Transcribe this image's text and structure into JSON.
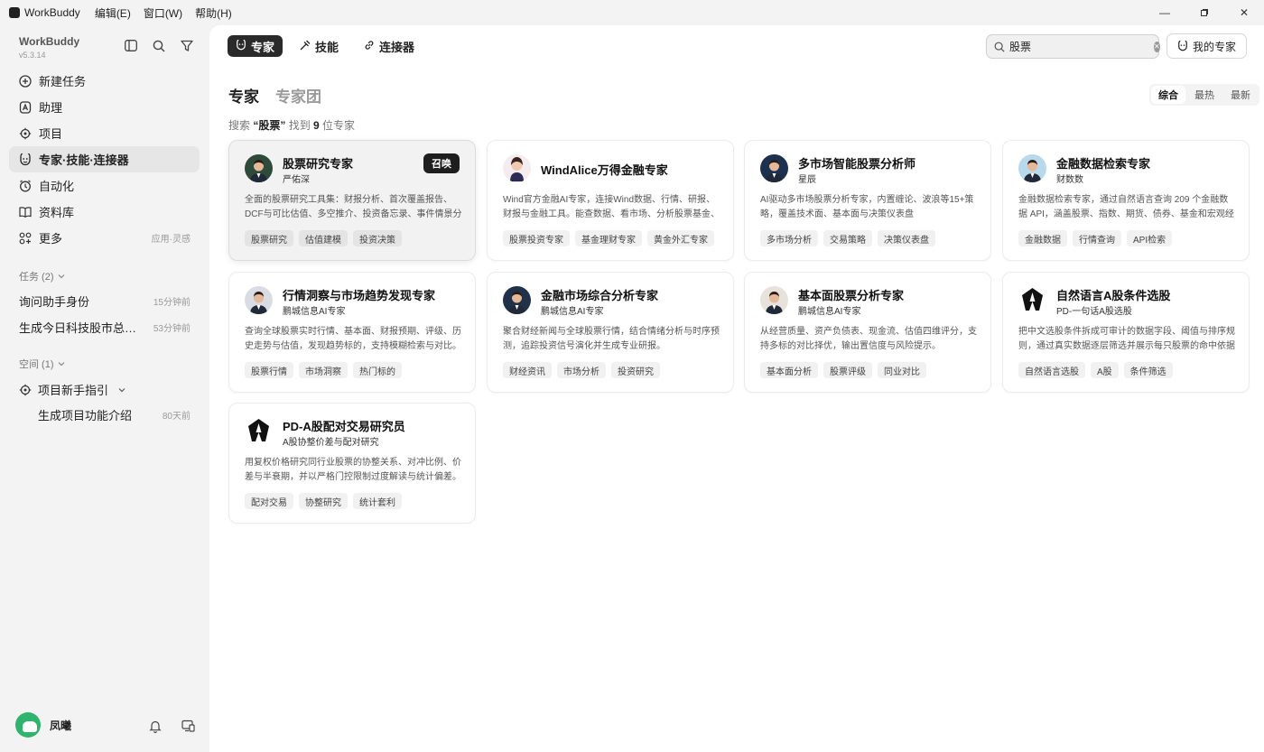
{
  "titlebar": {
    "app_name": "WorkBuddy",
    "menus": [
      "编辑(E)",
      "窗口(W)",
      "帮助(H)"
    ]
  },
  "sidebar": {
    "brand": "WorkBuddy",
    "version": "v5.3.14",
    "nav": [
      {
        "label": "新建任务",
        "icon": "plus-circle-icon"
      },
      {
        "label": "助理",
        "icon": "assistant-icon"
      },
      {
        "label": "项目",
        "icon": "project-icon"
      },
      {
        "label": "专家·技能·连接器",
        "icon": "expert-icon",
        "active": true
      },
      {
        "label": "自动化",
        "icon": "clock-icon"
      },
      {
        "label": "资料库",
        "icon": "book-icon"
      },
      {
        "label": "更多",
        "icon": "grid-icon",
        "hint": "应用·灵感"
      }
    ],
    "tasks_header": "任务 (2)",
    "tasks": [
      {
        "title": "询问助手身份",
        "time": "15分钟前"
      },
      {
        "title": "生成今日科技股市总结PPT",
        "time": "53分钟前"
      }
    ],
    "spaces_header": "空间 (1)",
    "space_name": "项目新手指引",
    "space_task": {
      "title": "生成项目功能介绍",
      "time": "80天前"
    },
    "user_name": "凤曦"
  },
  "main": {
    "tabs": [
      {
        "label": "专家",
        "active": true
      },
      {
        "label": "技能"
      },
      {
        "label": "连接器"
      }
    ],
    "search_value": "股票",
    "my_experts": "我的专家",
    "heading": "专家",
    "heading_sub": "专家团",
    "sort": [
      "综合",
      "最热",
      "最新"
    ],
    "result": {
      "prefix": "搜索 ",
      "query": "“股票”",
      "mid": " 找到 ",
      "count": "9",
      "suffix": " 位专家"
    },
    "summon_label": "召唤",
    "cards": [
      {
        "title": "股票研究专家",
        "sub": "严佑深",
        "desc": "全面的股票研究工具集：财报分析、首次覆盖报告、DCF与可比估值、多空推介、投资备忘录、事件情景分析",
        "tags": [
          "股票研究",
          "估值建模",
          "投资决策"
        ],
        "avatar": "#2e4a3a"
      },
      {
        "title": "WindAlice万得金融专家",
        "sub": "",
        "desc": "Wind官方金融AI专家，连接Wind数据、行情、研报、财报与金融工具。能查数据、看市场、分析股票基金、解读财报",
        "tags": [
          "股票投资专家",
          "基金理财专家",
          "黄金外汇专家"
        ],
        "avatar": "#f4ecef"
      },
      {
        "title": "多市场智能股票分析师",
        "sub": "星辰",
        "desc": "AI驱动多市场股票分析专家，内置缠论、波浪等15+策略，覆盖技术面、基本面与决策仪表盘",
        "tags": [
          "多市场分析",
          "交易策略",
          "决策仪表盘"
        ],
        "avatar": "#1c3050"
      },
      {
        "title": "金融数据检索专家",
        "sub": "财数数",
        "desc": "金融数据检索专家，通过自然语言查询 209 个金融数据 API，涵盖股票、指数、期货、债券、基金和宏观经济数据",
        "tags": [
          "金融数据",
          "行情查询",
          "API检索"
        ],
        "avatar": "#b8d8ec"
      },
      {
        "title": "行情洞察与市场趋势发现专家",
        "sub": "鹏城信息AI专家",
        "desc": "查询全球股票实时行情、基本面、财报预期、评级、历史走势与估值，发现趋势标的，支持模糊检索与对比。",
        "tags": [
          "股票行情",
          "市场洞察",
          "热门标的"
        ],
        "avatar": "#d9dde3"
      },
      {
        "title": "金融市场综合分析专家",
        "sub": "鹏城信息AI专家",
        "desc": "聚合财经新闻与全球股票行情，结合情绪分析与时序预测，追踪投资信号演化并生成专业研报。",
        "tags": [
          "财经资讯",
          "市场分析",
          "投资研究"
        ],
        "avatar": "#22314a"
      },
      {
        "title": "基本面股票分析专家",
        "sub": "鹏城信息AI专家",
        "desc": "从经营质量、资产负债表、现金流、估值四维评分，支持多标的对比择优，输出置信度与风险提示。",
        "tags": [
          "基本面分析",
          "股票评级",
          "同业对比"
        ],
        "avatar": "#e8e2dc"
      },
      {
        "title": "自然语言A股条件选股",
        "sub": "PD-一句话A股选股",
        "desc": "把中文选股条件拆成可审计的数据字段、阈值与排序规则，通过真实数据逐层筛选并展示每只股票的命中依据",
        "tags": [
          "自然语言选股",
          "A股",
          "条件筛选"
        ],
        "avatar": "#ffffff"
      },
      {
        "title": "PD-A股配对交易研究员",
        "sub": "A股协整价差与配对研究",
        "desc": "用复权价格研究同行业股票的协整关系、对冲比例、价差与半衰期，并以严格门控限制过度解读与统计偏差。",
        "tags": [
          "配对交易",
          "协整研究",
          "统计套利"
        ],
        "avatar": "#ffffff"
      }
    ]
  }
}
